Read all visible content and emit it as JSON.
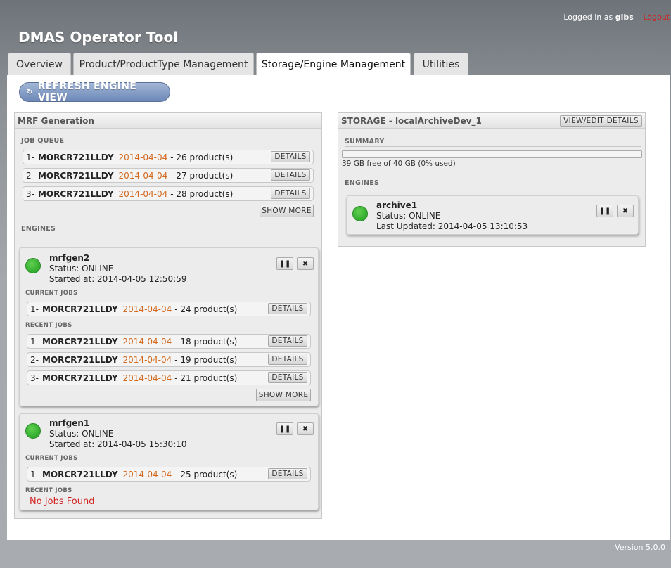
{
  "header": {
    "login_prefix": "Logged in as",
    "user": "gibs",
    "logout": "Logout",
    "title": "DMAS Operator Tool"
  },
  "tabs": [
    {
      "label": "Overview"
    },
    {
      "label": "Product/ProductType Management"
    },
    {
      "label": "Storage/Engine Management",
      "active": true
    },
    {
      "label": "Utilities"
    }
  ],
  "refresh_button": "REFRESH ENGINE VIEW",
  "mrf": {
    "title": "MRF Generation",
    "job_queue_label": "JOB QUEUE",
    "job_queue": [
      {
        "index": "1-",
        "name": "MORCR721LLDY",
        "date": "2014-04-04",
        "count": "- 26 product(s)"
      },
      {
        "index": "2-",
        "name": "MORCR721LLDY",
        "date": "2014-04-04",
        "count": "- 27 product(s)"
      },
      {
        "index": "3-",
        "name": "MORCR721LLDY",
        "date": "2014-04-04",
        "count": "- 28 product(s)"
      }
    ],
    "details_label": "DETAILS",
    "show_more_label": "SHOW MORE",
    "engines_label": "ENGINES",
    "engines": [
      {
        "name": "mrfgen2",
        "status": "Status: ONLINE",
        "started": "Started at: 2014-04-05 12:50:59",
        "current_jobs_label": "CURRENT JOBS",
        "current_jobs": [
          {
            "index": "1-",
            "name": "MORCR721LLDY",
            "date": "2014-04-04",
            "count": "- 24 product(s)"
          }
        ],
        "recent_jobs_label": "RECENT JOBS",
        "recent_jobs": [
          {
            "index": "1-",
            "name": "MORCR721LLDY",
            "date": "2014-04-04",
            "count": "- 18 product(s)"
          },
          {
            "index": "2-",
            "name": "MORCR721LLDY",
            "date": "2014-04-04",
            "count": "- 19 product(s)"
          },
          {
            "index": "3-",
            "name": "MORCR721LLDY",
            "date": "2014-04-04",
            "count": "- 21 product(s)"
          }
        ]
      },
      {
        "name": "mrfgen1",
        "status": "Status: ONLINE",
        "started": "Started at: 2014-04-05 15:30:10",
        "current_jobs_label": "CURRENT JOBS",
        "current_jobs": [
          {
            "index": "1-",
            "name": "MORCR721LLDY",
            "date": "2014-04-04",
            "count": "- 25 product(s)"
          }
        ],
        "recent_jobs_label": "RECENT JOBS",
        "no_jobs": "No Jobs Found"
      }
    ]
  },
  "storage": {
    "title": "STORAGE - localArchiveDev_1",
    "view_edit_label": "VIEW/EDIT DETAILS",
    "summary_label": "SUMMARY",
    "usage_text": "39 GB free of 40 GB (0% used)",
    "usage_fraction": 0,
    "engines_label": "ENGINES",
    "engine": {
      "name": "archive1",
      "status": "Status: ONLINE",
      "updated": "Last Updated: 2014-04-05 13:10:53"
    }
  },
  "controls": {
    "pause_glyph": "❚❚",
    "stop_glyph": "✖",
    "refresh_glyph": "↻"
  },
  "version": "Version 5.0.0",
  "colors": {
    "accent_date": "#d2691e",
    "online": "#2aa52a",
    "error": "#d21f1f",
    "refresh_button": "#6c88b8"
  }
}
